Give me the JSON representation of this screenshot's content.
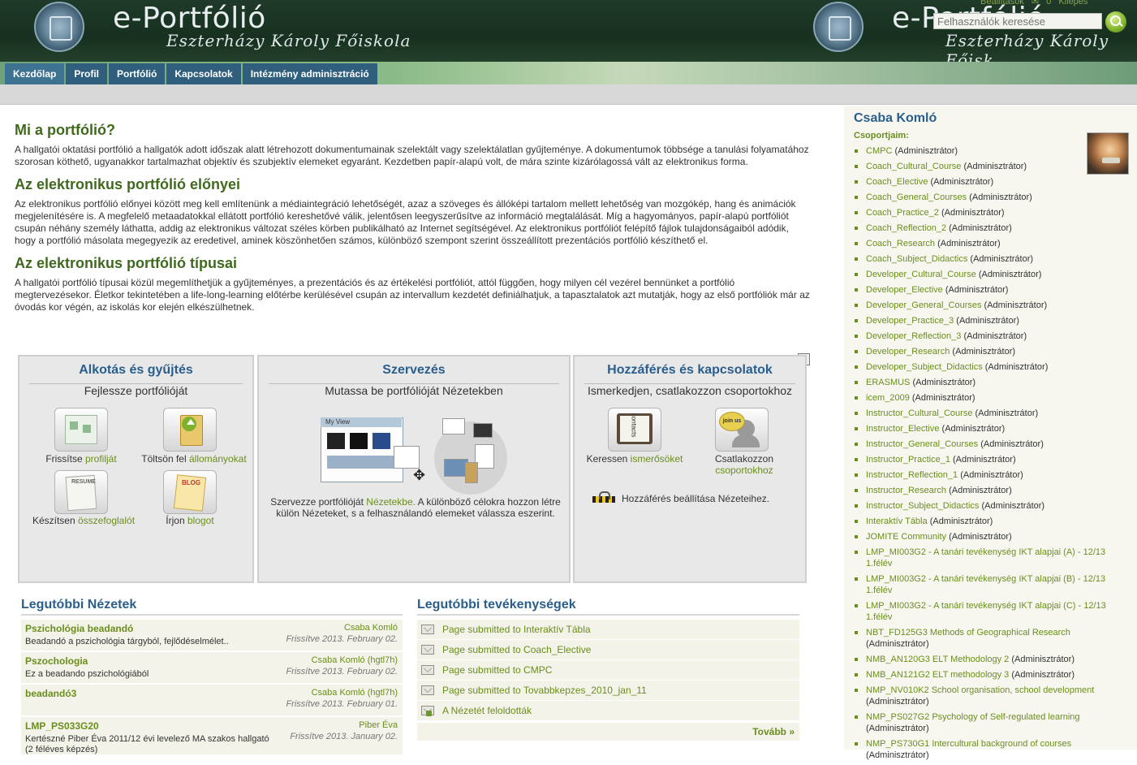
{
  "header": {
    "title": "e-Portfólió",
    "subtitle": "Eszterházy Károly Főiskola",
    "title_right": "e-Portfólió",
    "subtitle_right": "Eszterházy Károly Főisk",
    "top_links": [
      "Beállítások",
      "0",
      "Kilépés"
    ],
    "search_placeholder": "Felhasználók keresése"
  },
  "nav": {
    "tabs": [
      "Kezdőlap",
      "Profil",
      "Portfólió",
      "Kapcsolatok",
      "Intézmény adminisztráció"
    ]
  },
  "intro": {
    "h1": "Mi a portfólió?",
    "p1": "A hallgatói oktatási portfólió a hallgatók adott időszak alatt létrehozott dokumentumainak szelektált vagy szelektálatlan gyűjteménye. A dokumentumok többsége a tanulási folyamatához szorosan köthető, ugyanakkor tartalmazhat objektív és szubjektív elemeket egyaránt. Kezdetben papír-alapú volt, de mára szinte kizárólagossá vált az elektronikus forma.",
    "h2": "Az elektronikus portfólió előnyei",
    "p2": "Az elektronikus portfólió előnyei között meg kell említenünk a médiaintegráció lehetőségét, azaz a szöveges és állóképi tartalom mellett lehetőség van mozgókép, hang és animációk megjelenítésére is. A megfelelő metaadatokkal ellátott portfólió kereshetővé válik, jelentősen leegyszerűsítve az információ megtalálását. Míg a hagyományos, papír-alapú portfóliót csupán néhány személy láthatta, addig az elektronikus változat széles körben publikálható az Internet segítségével. Az elektronikus portfóliót felépítő fájlok tulajdonságaiból adódik, hogy a portfólió másolata megegyezik az eredetivel, aminek köszönhetően számos, különböző szempont szerint összeállított prezentációs portfólió készíthető el.",
    "h3": "Az elektronikus portfólió típusai",
    "p3": "A hallgatói portfólió típusai közül megemlíthetjük a gyűjteményes, a prezentációs és az értékelési portfóliót, attól függően, hogy milyen cél vezérel bennünket a portfólió megtervezésekor. Életkor tekintetében a life-long-learning előtérbe kerülésével csupán az intervallum kezdetét definiálhatjuk, a tapasztalatok azt mutatják, hogy az első portfóliók már az óvodás kor végén, az iskolás kor elején elkészülhetnek."
  },
  "dashboard": {
    "close": "✕",
    "create": {
      "title": "Alkotás és gyűjtés",
      "sub": "Fejlessze portfólióját",
      "items": [
        {
          "pre": "Frissítse ",
          "link": "profilját",
          "icon": "profile-icon"
        },
        {
          "pre": "Töltsön fel ",
          "link": "állományokat",
          "icon": "upload-icon"
        },
        {
          "pre": "Készítsen ",
          "link": "összefoglalót",
          "icon": "resume-icon"
        },
        {
          "pre": "Írjon ",
          "link": "blogot",
          "icon": "blog-icon"
        }
      ]
    },
    "organize": {
      "title": "Szervezés",
      "sub": "Mutassa be portfólióját Nézetekben",
      "text_pre": "Szervezze portfólióját ",
      "text_link": "Nézetekbe.",
      "text_post": " A különböző célokra hozzon létre külön Nézeteket, s a felhasználandó elemeket válassza eszerint.",
      "illus_label": "My View"
    },
    "share": {
      "title": "Hozzáférés és kapcsolatok",
      "sub": "Ismerkedjen, csatlakozzon csoportokhoz",
      "find_pre": "Keressen ",
      "find_link": "ismerősöket",
      "join_pre": "Csatlakozzon",
      "join_link": "csoportokhoz",
      "access": "Hozzáférés beállítása Nézeteihez.",
      "contacts_label": "contacts",
      "join_label": "join us"
    }
  },
  "recent_views": {
    "title": "Legutóbbi Nézetek",
    "items": [
      {
        "title": "Pszichológia beadandó",
        "desc": "Beadandó a pszichológia tárgyból, fejlődéselmélet..",
        "owner": "Csaba Komló",
        "updated": "Frissítve 2013. February 02."
      },
      {
        "title": "Pszochologia",
        "desc": "Ez a beadando pszichológiából",
        "owner": "Csaba Komló (hgtl7h)",
        "updated": "Frissítve 2013. February 02."
      },
      {
        "title": "beadandó3",
        "desc": "",
        "owner": "Csaba Komló (hgtl7h)",
        "updated": "Frissítve 2013. February 01."
      },
      {
        "title": "LMP_PS033G20",
        "desc": "Kertészné Piber Éva 2011/12 évi levelező MA szakos hallgató (2 féléves képzés)",
        "owner": "Piber Éva",
        "updated": "Frissítve 2013. January 02."
      }
    ]
  },
  "recent_activities": {
    "title": "Legutóbbi tevékenységek",
    "items": [
      "Page submitted to Interaktív Tábla",
      "Page submitted to Coach_Elective",
      "Page submitted to CMPC",
      "Page submitted to Tovabbkepzes_2010_jan_11",
      "A Nézetét feloldották"
    ],
    "more": "Tovább »"
  },
  "sidebar": {
    "user": "Csaba Komló",
    "groups_label": "Csoportjaim:",
    "groups": [
      {
        "name": "CMPC",
        "role": "(Adminisztrátor)"
      },
      {
        "name": "Coach_Cultural_Course",
        "role": "(Adminisztrátor)"
      },
      {
        "name": "Coach_Elective",
        "role": "(Adminisztrátor)"
      },
      {
        "name": "Coach_General_Courses",
        "role": "(Adminisztrátor)"
      },
      {
        "name": "Coach_Practice_2",
        "role": "(Adminisztrátor)"
      },
      {
        "name": "Coach_Reflection_2",
        "role": "(Adminisztrátor)"
      },
      {
        "name": "Coach_Research",
        "role": "(Adminisztrátor)"
      },
      {
        "name": "Coach_Subject_Didactics",
        "role": "(Adminisztrátor)"
      },
      {
        "name": "Developer_Cultural_Course",
        "role": "(Adminisztrátor)"
      },
      {
        "name": "Developer_Elective",
        "role": "(Adminisztrátor)"
      },
      {
        "name": "Developer_General_Courses",
        "role": "(Adminisztrátor)"
      },
      {
        "name": "Developer_Practice_3",
        "role": "(Adminisztrátor)"
      },
      {
        "name": "Developer_Reflection_3",
        "role": "(Adminisztrátor)"
      },
      {
        "name": "Developer_Research",
        "role": "(Adminisztrátor)"
      },
      {
        "name": "Developer_Subject_Didactics",
        "role": "(Adminisztrátor)"
      },
      {
        "name": "ERASMUS",
        "role": "(Adminisztrátor)"
      },
      {
        "name": "icem_2009",
        "role": "(Adminisztrátor)"
      },
      {
        "name": "Instructor_Cultural_Course",
        "role": "(Adminisztrátor)"
      },
      {
        "name": "Instructor_Elective",
        "role": "(Adminisztrátor)"
      },
      {
        "name": "Instructor_General_Courses",
        "role": "(Adminisztrátor)"
      },
      {
        "name": "Instructor_Practice_1",
        "role": "(Adminisztrátor)"
      },
      {
        "name": "Instructor_Reflection_1",
        "role": "(Adminisztrátor)"
      },
      {
        "name": "Instructor_Research",
        "role": "(Adminisztrátor)"
      },
      {
        "name": "Instructor_Subject_Didactics",
        "role": "(Adminisztrátor)"
      },
      {
        "name": "Interaktív Tábla",
        "role": "(Adminisztrátor)"
      },
      {
        "name": "JOMITE Community",
        "role": "(Adminisztrátor)"
      },
      {
        "name": "LMP_MI003G2 - A tanári tevékenység IKT alapjai (A) - 12/13 1.félév",
        "role": ""
      },
      {
        "name": "LMP_MI003G2 - A tanári tevékenység IKT alapjai (B) - 12/13 1.félév",
        "role": ""
      },
      {
        "name": "LMP_MI003G2 - A tanári tevékenység IKT alapjai (C) - 12/13 1.félév",
        "role": ""
      },
      {
        "name": "NBT_FD125G3 Methods of Geographical Research",
        "role": "(Adminisztrátor)"
      },
      {
        "name": "NMB_AN120G3 ELT Methodology 2",
        "role": "(Adminisztrátor)"
      },
      {
        "name": "NMB_AN121G2 ELT methodology 3",
        "role": "(Adminisztrátor)"
      },
      {
        "name": "NMP_NV010K2 School organisation, school development",
        "role": "(Adminisztrátor)"
      },
      {
        "name": "NMP_PS027G2 Psychology of Self-regulated learning",
        "role": "(Adminisztrátor)"
      },
      {
        "name": "NMP_PS730G1 Intercultural background of courses",
        "role": "(Adminisztrátor)"
      }
    ]
  }
}
